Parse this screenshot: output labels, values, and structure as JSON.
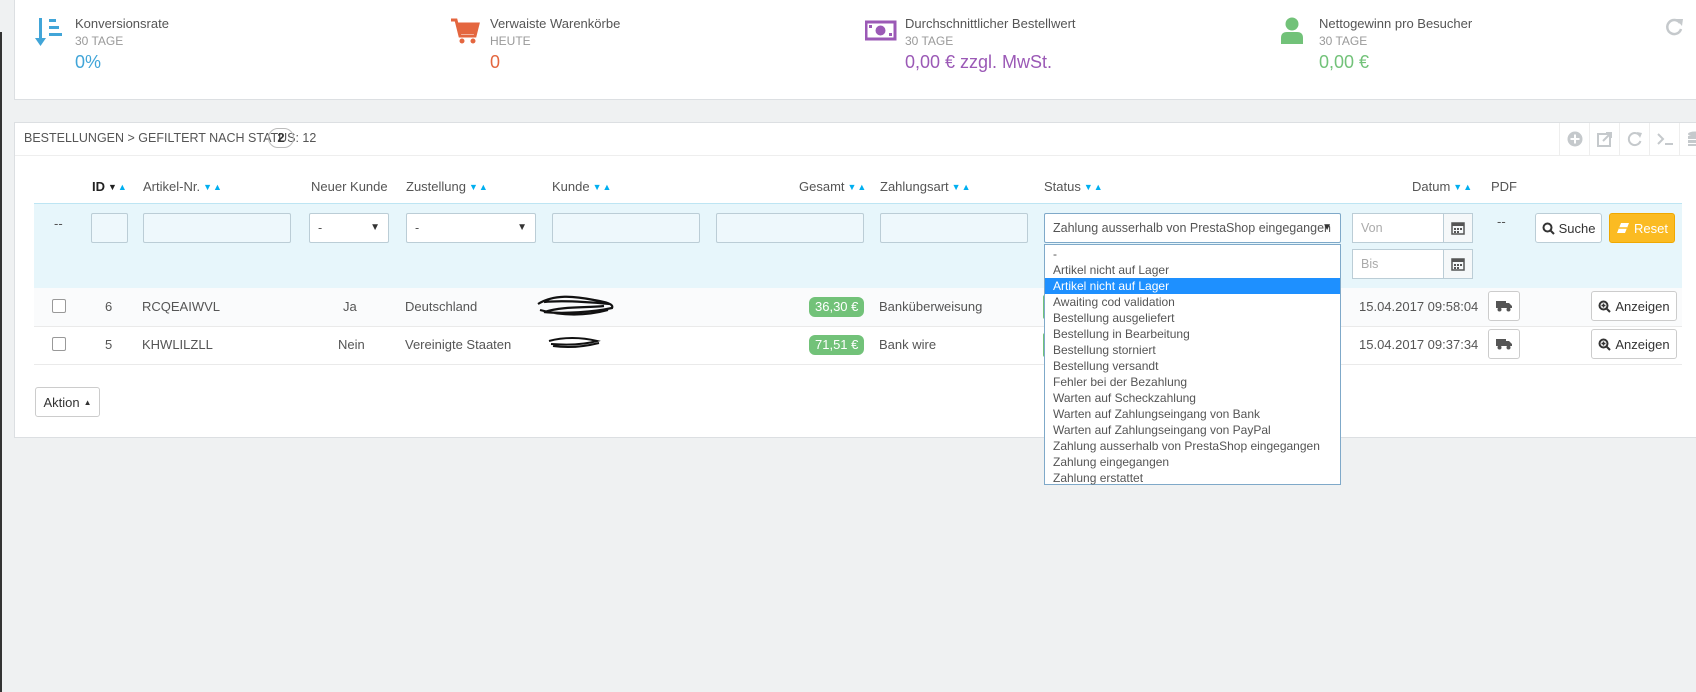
{
  "kpis": [
    {
      "label": "Konversionsrate",
      "period": "30 TAGE",
      "value": "0%",
      "color": "#41a5d8",
      "icon": "sort-amount-down-icon"
    },
    {
      "label": "Verwaiste Warenkörbe",
      "period": "HEUTE",
      "value": "0",
      "color": "#e4663f",
      "icon": "shopping-cart-icon"
    },
    {
      "label": "Durchschnittlicher Bestellwert",
      "period": "30 TAGE",
      "value": "0,00 € zzgl. MwSt.",
      "color": "#9b59b6",
      "icon": "money-icon"
    },
    {
      "label": "Nettogewinn pro Besucher",
      "period": "30 TAGE",
      "value": "0,00 €",
      "color": "#72c279",
      "icon": "user-icon"
    }
  ],
  "orders": {
    "title": "Bestellungen > Gefiltert nach Status: 12",
    "count": "2",
    "columns": {
      "id": "ID",
      "ref": "Artikel-Nr.",
      "new_customer": "Neuer Kunde",
      "delivery": "Zustellung",
      "customer": "Kunde",
      "total": "Gesamt",
      "payment": "Zahlungsart",
      "status": "Status",
      "date": "Datum",
      "pdf": "PDF"
    },
    "filters": {
      "placeholder_dash": "--",
      "new_customer_select": "-",
      "delivery_select": "-",
      "status_select": "Zahlung ausserhalb von PrestaShop eingegangen",
      "date_from": "Von",
      "date_to": "Bis",
      "pdf_dash": "--",
      "search_label": "Suche",
      "reset_label": "Reset"
    },
    "rows": [
      {
        "id": "6",
        "ref": "RCQEAIWVL",
        "new_customer": "Ja",
        "delivery": "Deutschland",
        "total": "36,30 €",
        "payment": "Banküberweisung",
        "date": "15.04.2017 09:58:04",
        "view_label": "Anzeigen"
      },
      {
        "id": "5",
        "ref": "KHWLILZLL",
        "new_customer": "Nein",
        "delivery": "Vereinigte Staaten",
        "total": "71,51 €",
        "payment": "Bank wire",
        "date": "15.04.2017 09:37:34",
        "view_label": "Anzeigen"
      }
    ],
    "bulk_action_label": "Aktion"
  },
  "status_options": [
    "-",
    "Artikel nicht auf Lager",
    "Artikel nicht auf Lager",
    "Awaiting cod validation",
    "Bestellung ausgeliefert",
    "Bestellung in Bearbeitung",
    "Bestellung storniert",
    "Bestellung versandt",
    "Fehler bei der Bezahlung",
    "Warten auf Scheckzahlung",
    "Warten auf Zahlungseingang von Bank",
    "Warten auf Zahlungseingang von PayPal",
    "Zahlung ausserhalb von PrestaShop eingegangen",
    "Zahlung eingegangen",
    "Zahlung erstattet"
  ],
  "status_selected_index": 2,
  "colors": {
    "accent": "#00aff0",
    "success": "#72c279",
    "warning": "#fbbb22",
    "highlight": "#1e90ff"
  }
}
